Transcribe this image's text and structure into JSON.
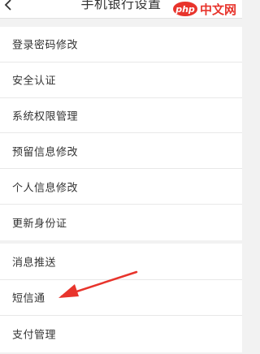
{
  "header": {
    "title": "手机银行设置"
  },
  "watermark": {
    "badge": "php",
    "text": "中文网"
  },
  "groups": [
    {
      "items": [
        {
          "label": "登录密码修改"
        },
        {
          "label": "安全认证"
        },
        {
          "label": "系统权限管理"
        },
        {
          "label": "预留信息修改"
        },
        {
          "label": "个人信息修改"
        },
        {
          "label": "更新身份证"
        }
      ]
    },
    {
      "items": [
        {
          "label": "消息推送"
        },
        {
          "label": "短信通"
        },
        {
          "label": "支付管理"
        }
      ]
    }
  ],
  "colors": {
    "background": "#f2f2f2",
    "card": "#ffffff",
    "text": "#333333",
    "divider": "#e8e8e8",
    "annotation_arrow": "#e8342c",
    "watermark": "#e8342c"
  },
  "icons": {
    "back": "back-icon",
    "annotation": "arrow-annotation"
  }
}
